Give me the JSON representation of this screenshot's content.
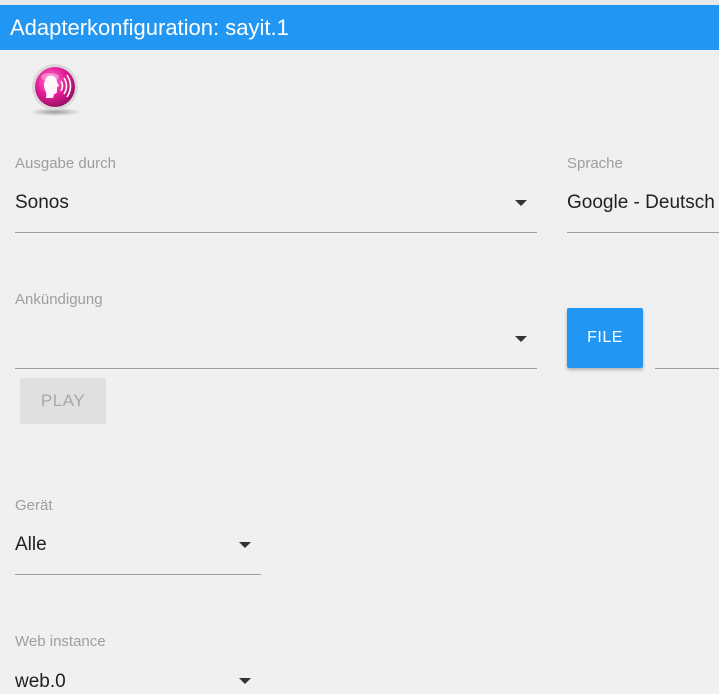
{
  "window": {
    "title": "Adapterkonfiguration: sayit.1"
  },
  "form": {
    "ausgabe": {
      "label": "Ausgabe durch",
      "value": "Sonos"
    },
    "sprache": {
      "label": "Sprache",
      "value": "Google - Deutsch"
    },
    "ankuendigung": {
      "label": "Ankündigung",
      "value": ""
    },
    "file_button": "FILE",
    "play_button": "PLAY",
    "geraet": {
      "label": "Gerät",
      "value": "Alle"
    },
    "web_instance": {
      "label": "Web instance",
      "value": "web.0"
    }
  },
  "colors": {
    "accent": "#2196f3",
    "logo": "#e91e9a"
  },
  "icons": {
    "logo": "sayit-speaking-head-icon",
    "dropdown": "caret-down-icon"
  }
}
